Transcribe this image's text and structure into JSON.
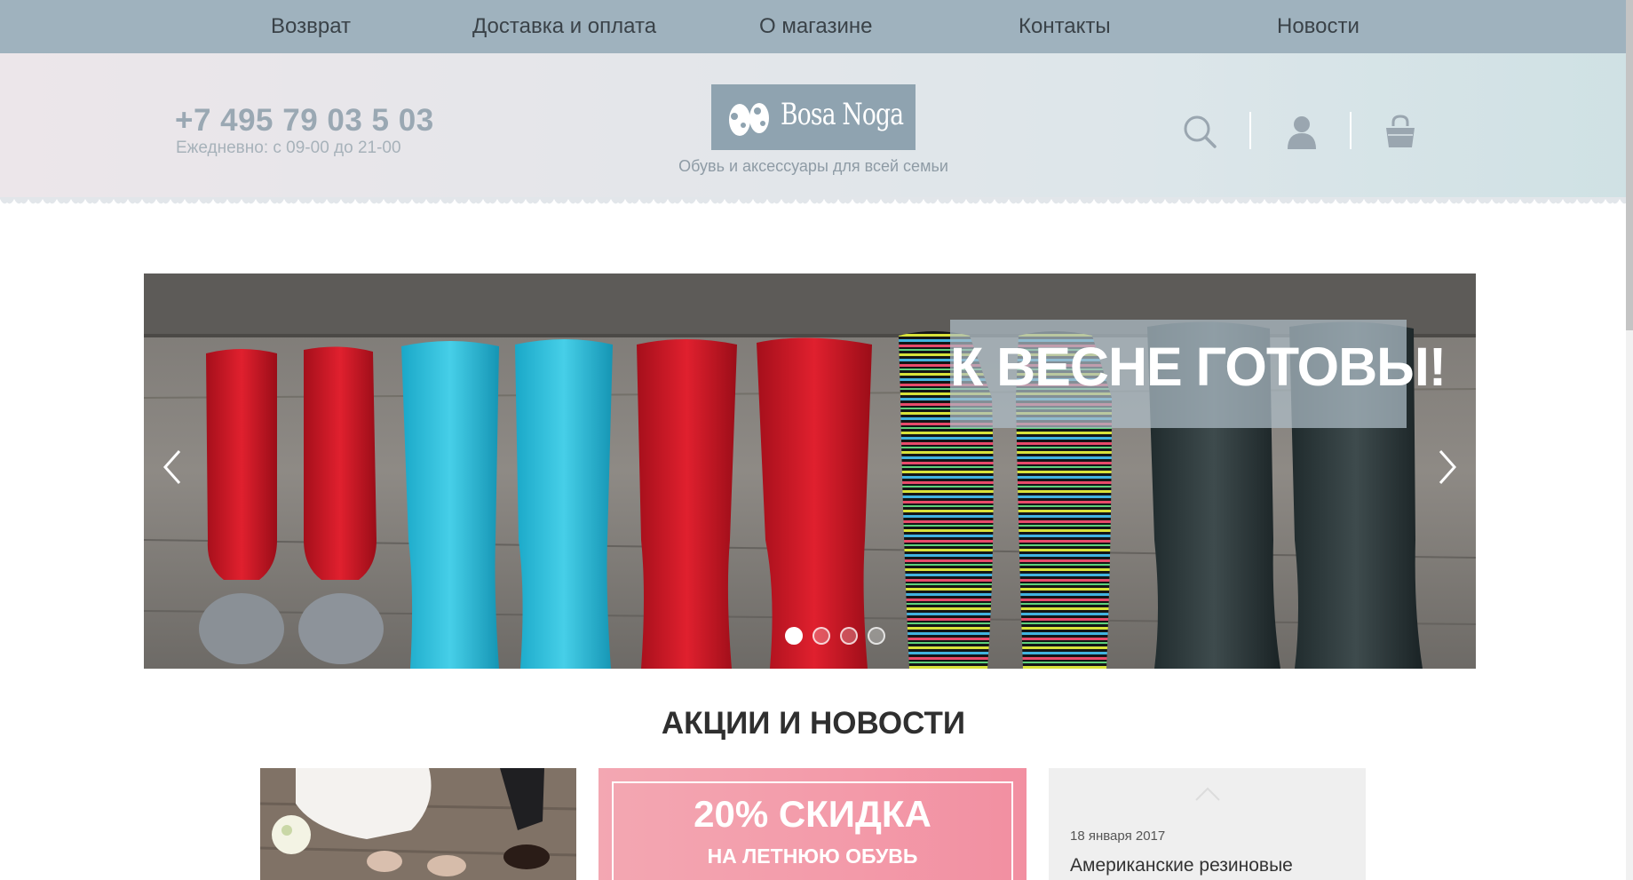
{
  "nav": {
    "items": [
      "Возврат",
      "Доставка и оплата",
      "О магазине",
      "Контакты",
      "Новости"
    ]
  },
  "header": {
    "phone": "+7 495 79 03 5 03",
    "hours": "Ежедневно: с 09-00 до 21-00",
    "logo_text": "Bosa Noga",
    "tagline": "Обувь и аксессуары для всей семьи",
    "icons": [
      "search-icon",
      "user-icon",
      "cart-icon"
    ]
  },
  "slider": {
    "banner_text": "К ВЕСНЕ ГОТОВЫ!",
    "slide_count": 4,
    "active_slide": 1
  },
  "news": {
    "title": "АКЦИИ И НОВОСТИ",
    "promo_big": "20% СКИДКА",
    "promo_small": "НА ЛЕТНЮЮ ОБУВЬ",
    "item_date": "18 января 2017",
    "item_title": "Американские резиновые"
  },
  "colors": {
    "nav_bg": "#9fb2be",
    "logo_bg": "#8fa3b0",
    "promo_pink": "#f39aa9"
  }
}
